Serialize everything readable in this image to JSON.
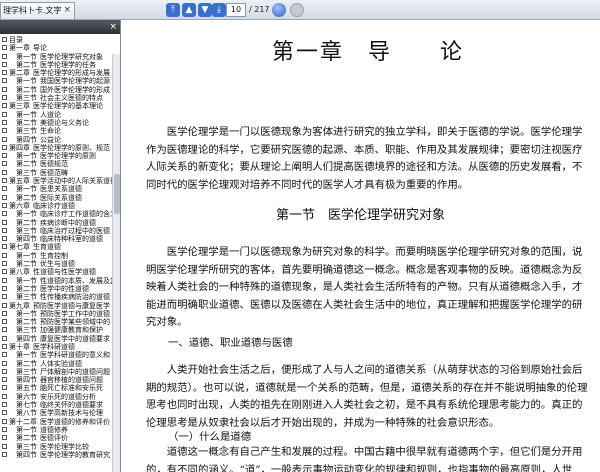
{
  "toolbar": {
    "tab_title": "理学科卜卡.文字部",
    "tab_close": "×",
    "page_current": "10",
    "page_total": "/ 217"
  },
  "sidebar": {
    "close": "×",
    "items": [
      {
        "level": 0,
        "text": "目录"
      },
      {
        "level": 1,
        "num": "第一章",
        "text": "导论"
      },
      {
        "level": 2,
        "num": "第一节",
        "text": "医学伦理学研究对象"
      },
      {
        "level": 2,
        "num": "第二节",
        "text": "医学伦理学的任务"
      },
      {
        "level": 1,
        "num": "第二章",
        "text": "医学伦理学的形成与发展"
      },
      {
        "level": 2,
        "num": "第一节",
        "text": "我国医学伦理学的起源"
      },
      {
        "level": 2,
        "num": "第二节",
        "text": "国外医学伦理学的形成"
      },
      {
        "level": 2,
        "num": "第三节",
        "text": "社会主义医德的特点"
      },
      {
        "level": 1,
        "num": "第三章",
        "text": "医学伦理学的基本理论"
      },
      {
        "level": 2,
        "num": "第一节",
        "text": "人道论"
      },
      {
        "level": 2,
        "num": "第二节",
        "text": "美德论与义务论"
      },
      {
        "level": 2,
        "num": "第三节",
        "text": "生命论"
      },
      {
        "level": 2,
        "num": "第四节",
        "text": "公益论"
      },
      {
        "level": 1,
        "num": "第四章",
        "text": "医学伦理学的原则、规范"
      },
      {
        "level": 2,
        "num": "第一节",
        "text": "医学伦理学的原则"
      },
      {
        "level": 2,
        "num": "第二节",
        "text": "医德规范"
      },
      {
        "level": 2,
        "num": "第三节",
        "text": "医德范畴"
      },
      {
        "level": 1,
        "num": "第五章",
        "text": "医学活动中的人际关系道德"
      },
      {
        "level": 2,
        "num": "第一节",
        "text": "医患关系道德"
      },
      {
        "level": 2,
        "num": "第二节",
        "text": "医际关系道德"
      },
      {
        "level": 1,
        "num": "第六章",
        "text": "临床诊疗道德"
      },
      {
        "level": 2,
        "num": "第一节",
        "text": "临床诊疗工作道德的含义"
      },
      {
        "level": 2,
        "num": "第二节",
        "text": "疾病诊断中的道德"
      },
      {
        "level": 2,
        "num": "第三节",
        "text": "临床治疗过程中的医德"
      },
      {
        "level": 2,
        "num": "第四节",
        "text": "临床特种科室的道德"
      },
      {
        "level": 1,
        "num": "第七章",
        "text": "生育道德"
      },
      {
        "level": 2,
        "num": "第一节",
        "text": "生育控制"
      },
      {
        "level": 2,
        "num": "第二节",
        "text": "优生与道德"
      },
      {
        "level": 1,
        "num": "第八章",
        "text": "性道德与性医学道德"
      },
      {
        "level": 2,
        "num": "第一节",
        "text": "性道德的本质、发展及其"
      },
      {
        "level": 2,
        "num": "第二节",
        "text": "医学中的性道德"
      },
      {
        "level": 2,
        "num": "第三节",
        "text": "性传播疾病防治的道德"
      },
      {
        "level": 1,
        "num": "第九章",
        "text": "预防医学道德与康复医学"
      },
      {
        "level": 2,
        "num": "第一节",
        "text": "预防医学工作中的道德"
      },
      {
        "level": 2,
        "num": "第二节",
        "text": "预防医学某些领域中的"
      },
      {
        "level": 2,
        "num": "第三节",
        "text": "加强健康教育和保护"
      },
      {
        "level": 2,
        "num": "第四节",
        "text": "康复医学中的道德要求"
      },
      {
        "level": 1,
        "num": "第十章",
        "text": "医学科研道德"
      },
      {
        "level": 2,
        "num": "第一节",
        "text": "医学科研道德的意义和"
      },
      {
        "level": 2,
        "num": "第二节",
        "text": "人体实验道德"
      },
      {
        "level": 2,
        "num": "第三节",
        "text": "尸体解剖中的道德问题"
      },
      {
        "level": 2,
        "num": "第四节",
        "text": "器官移植的道德问题"
      },
      {
        "level": 2,
        "num": "第五节",
        "text": "脑死亡标准和安乐死"
      },
      {
        "level": 2,
        "num": "第六节",
        "text": "安乐死的道德分析"
      },
      {
        "level": 2,
        "num": "第七节",
        "text": "临终关怀的道德要求"
      },
      {
        "level": 2,
        "num": "第八节",
        "text": "医学高新技术与伦理"
      },
      {
        "level": 1,
        "num": "第十二章",
        "text": "医学道德的修养和评价"
      },
      {
        "level": 2,
        "num": "第一节",
        "text": "道德修养"
      },
      {
        "level": 2,
        "num": "第二节",
        "text": "医德评价"
      },
      {
        "level": 2,
        "num": "第三节",
        "text": "医学伦理学比较"
      },
      {
        "level": 2,
        "num": "第四节",
        "text": "医学伦理学的教育研究"
      }
    ]
  },
  "document": {
    "chapter_title": "第一章　导　　论",
    "para1": "医学伦理学是一门以医德现象为客体进行研究的独立学科，即关于医德的学说。医学伦理学作为医德理论的科学，它要研究医德的起源、本质、职能、作用及其发展规律；要密切注视医疗人际关系的新变化；要从理论上阐明人们提高医德境界的途径和方法。从医德的历史发展看，不同时代的医学伦理观对培养不同时代的医学人才具有极为重要的作用。",
    "section_title": "第一节　医学伦理学研究对象",
    "para2": "医学伦理学是一门以医德现象为研究对象的科学。而要明晓医学伦理学研究对象的范围，说明医学伦理学所研究的客体，首先要明确道德这一概念。概念是客观事物的反映。道德概念为反映着人类社会的一种特殊的道德现象，是人类社会生活所特有的产物。只有从道德概念入手，才能进而明确职业道德、医德以及医德在人类社会生活中的地位，真正理解和把握医学伦理学的研究对象。",
    "sub_heading1": "一、道德、职业道德与医德",
    "para3": "人类开始社会生活之后，便形成了人与人之间的道德关系（从萌芽状态的习俗到原始社会后期的规范）。也可以说，道德就是一个关系的范畴，但是，道德关系的存在并不能说明抽象的伦理思考也同时出现，人类的祖先在刚刚进入人类社会之初，是不具有系统伦理思考能力的。真正的伦理思考是从奴隶社会以后才开始出现的，并成为一种特殊的社会意识形态。",
    "sub_heading2": "（一）什么是道德",
    "para4": "道德这一概念有自己产生和发展的过程。中国古籍中很早就有道德两个字，但它们是分开用的，有不同的涵义。“道”，一般表示事物运动变化的规律和规则，也指事物的最高原则，人世"
  }
}
